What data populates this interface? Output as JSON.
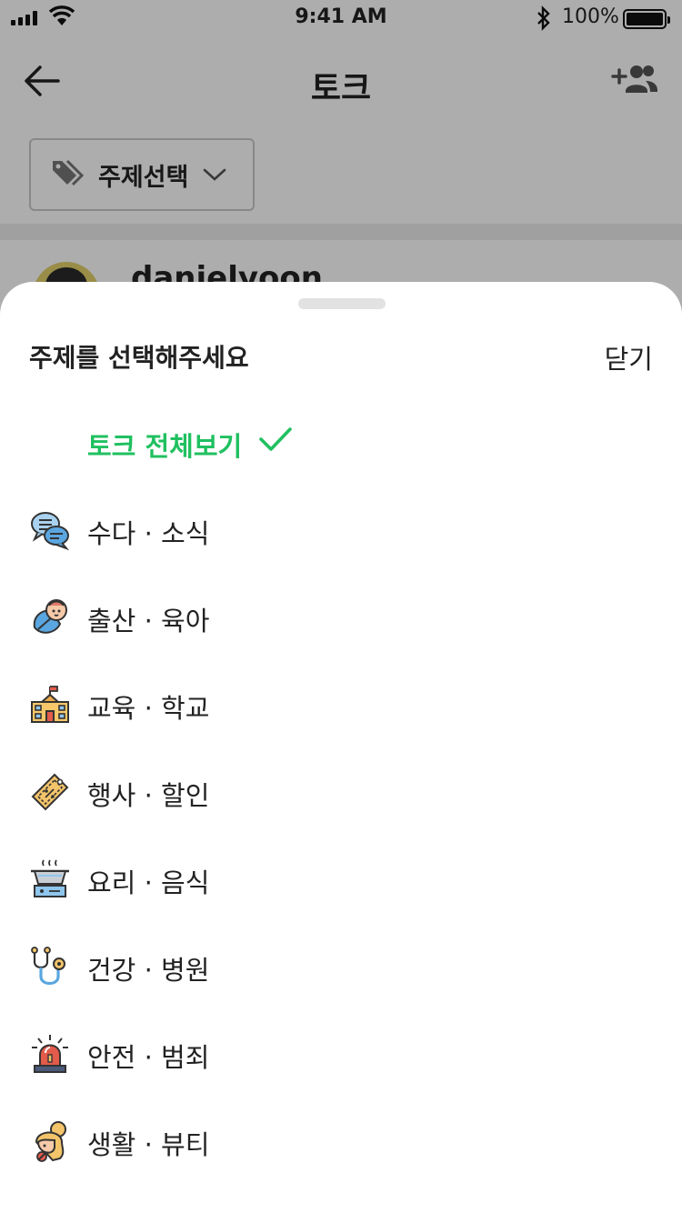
{
  "status_bar": {
    "time": "9:41 AM",
    "battery": "100%"
  },
  "header": {
    "title": "토크"
  },
  "topic_select": {
    "label": "주제선택"
  },
  "post": {
    "author": "danielyoon"
  },
  "sheet": {
    "title": "주제를 선택해주세요",
    "close_label": "닫기",
    "items": [
      {
        "label": "토크 전체보기",
        "icon": "check-icon",
        "selected": true
      },
      {
        "label": "수다 · 소식",
        "icon": "chat-bubbles-icon"
      },
      {
        "label": "출산 · 육아",
        "icon": "baby-icon"
      },
      {
        "label": "교육 · 학교",
        "icon": "school-icon"
      },
      {
        "label": "행사 · 할인",
        "icon": "discount-tag-icon"
      },
      {
        "label": "요리 · 음식",
        "icon": "cooking-pot-icon"
      },
      {
        "label": "건강 · 병원",
        "icon": "stethoscope-icon"
      },
      {
        "label": "안전 · 범죄",
        "icon": "siren-icon"
      },
      {
        "label": "생활 · 뷰티",
        "icon": "beauty-icon"
      }
    ]
  },
  "colors": {
    "accent": "#20c060",
    "dim_overlay": "rgba(0,0,0,0.32)"
  }
}
